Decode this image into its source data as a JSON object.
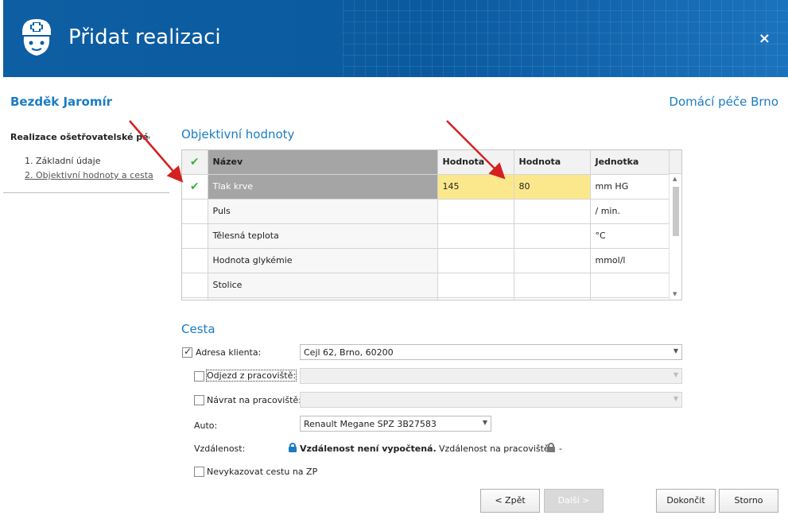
{
  "window": {
    "title": "Přidat realizaci",
    "close_label": "×"
  },
  "patient_name": "Bezděk Jaromír",
  "organization": "Domácí péče Brno",
  "nav": {
    "heading": "Realizace ošetřovatelské péče",
    "items": [
      {
        "label": "1. Základní údaje"
      },
      {
        "label": "2. Objektivní hodnoty a cesta"
      }
    ]
  },
  "objective": {
    "title": "Objektivní hodnoty",
    "columns": {
      "check": "✔",
      "name": "Název",
      "value1": "Hodnota",
      "value2": "Hodnota",
      "unit": "Jednotka"
    },
    "rows": [
      {
        "check": "✔",
        "name": "Tlak krve",
        "value1": "145",
        "value2": "80",
        "unit": "mm HG"
      },
      {
        "check": "",
        "name": "Puls",
        "value1": "",
        "value2": "",
        "unit": "/ min."
      },
      {
        "check": "",
        "name": "Tělesná teplota",
        "value1": "",
        "value2": "",
        "unit": "°C"
      },
      {
        "check": "",
        "name": "Hodnota glykémie",
        "value1": "",
        "value2": "",
        "unit": "mmol/l"
      },
      {
        "check": "",
        "name": "Stolice",
        "value1": "",
        "value2": "",
        "unit": ""
      },
      {
        "check": "",
        "name": "",
        "value1": "",
        "value2": "",
        "unit": ""
      }
    ]
  },
  "route": {
    "title": "Cesta",
    "client_address": {
      "label": "Adresa klienta:",
      "checked": true,
      "value": "Cejl 62, Brno, 60200"
    },
    "departure": {
      "label": "Odjezd z pracoviště:",
      "checked": false,
      "value": ""
    },
    "return": {
      "label": "Návrat na pracoviště:",
      "checked": false,
      "value": ""
    },
    "car": {
      "label": "Auto:",
      "value": "Renault Megane SPZ 3B27583"
    },
    "distance": {
      "label": "Vzdálenost:",
      "status": "Vzdálenost není vypočtená.",
      "workplace_label": "Vzdálenost na pracoviště:",
      "workplace_value": "-"
    },
    "no_report": {
      "label": "Nevykazovat cestu na ZP",
      "checked": false
    }
  },
  "buttons": {
    "back": "< Zpět",
    "next": "Další >",
    "finish": "Dokončit",
    "cancel": "Storno"
  },
  "colors": {
    "header_blue": "#0e5ea3",
    "accent_blue": "#1a7cc4",
    "check_green": "#3eb13e",
    "highlight_yellow": "#fbe88c",
    "annotation_red": "#d42020",
    "lock_blue": "#1a7cc4",
    "lock_gray": "#777777"
  },
  "icons": {
    "logo": "nurse-icon",
    "close": "close-icon",
    "check": "checkmark-icon",
    "lock": "lock-icon"
  }
}
